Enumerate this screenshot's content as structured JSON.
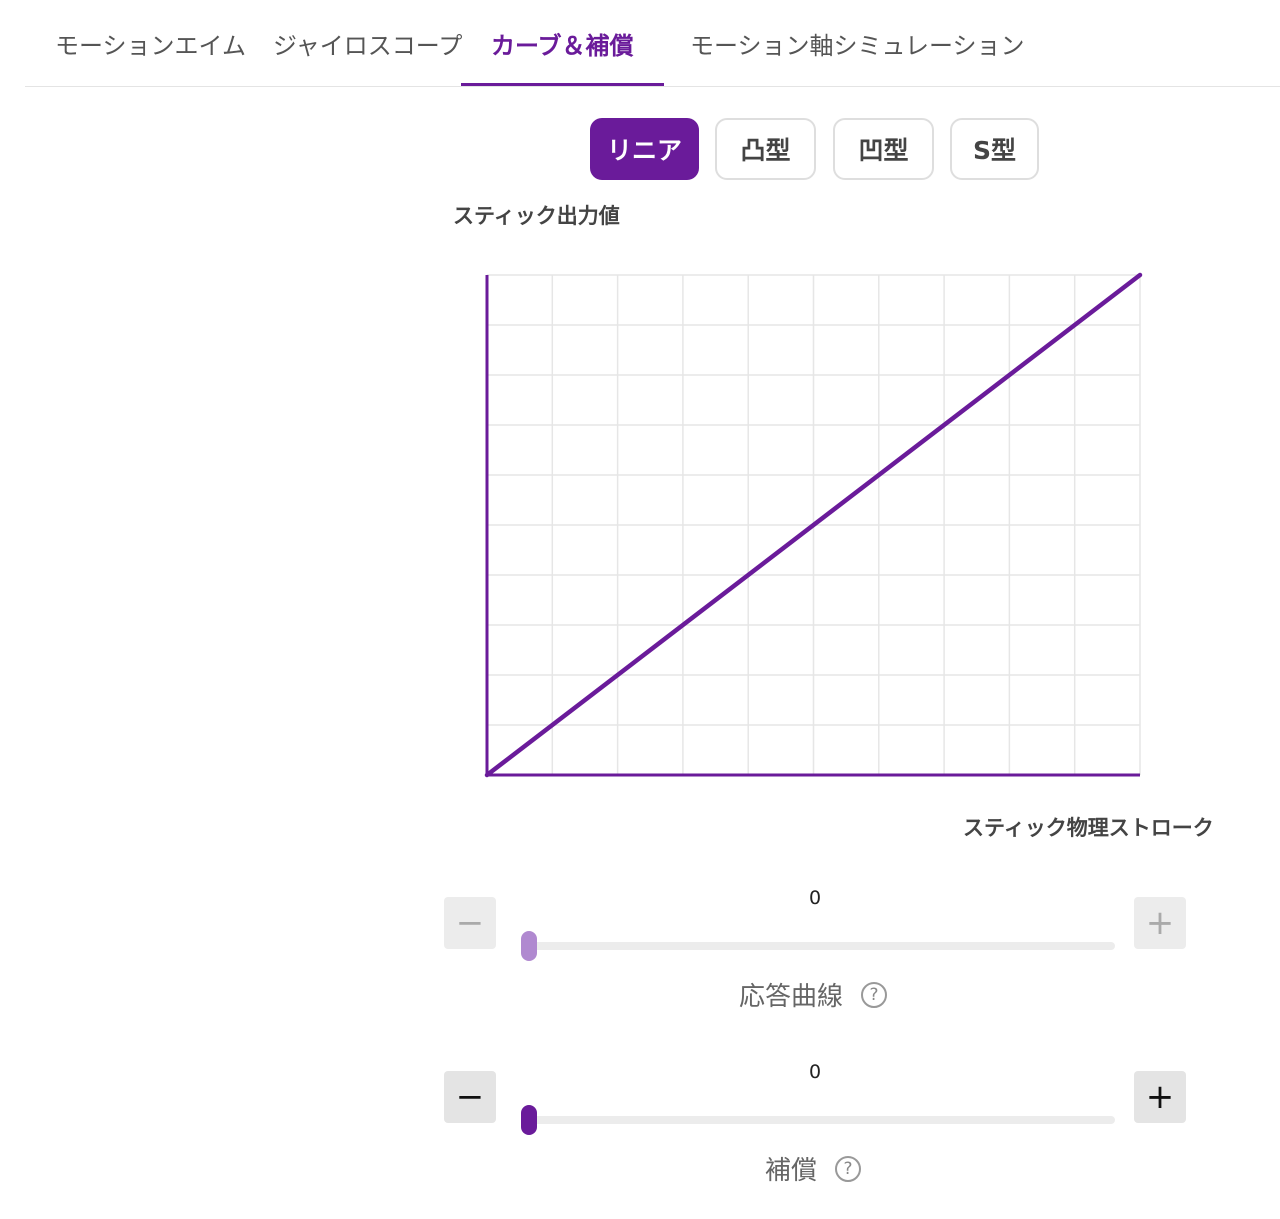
{
  "tabs": [
    {
      "label": "モーションエイム"
    },
    {
      "label": "ジャイロスコープ"
    },
    {
      "label": "カーブ＆補償"
    },
    {
      "label": "モーション軸シミュレーション"
    }
  ],
  "active_tab": "カーブ＆補償",
  "presets": [
    {
      "label": "リニア"
    },
    {
      "label": "凸型"
    },
    {
      "label": "凹型"
    },
    {
      "label": "S型"
    }
  ],
  "active_preset": "リニア",
  "chart": {
    "ylabel": "スティック出力値",
    "xlabel": "スティック物理ストローク"
  },
  "chart_data": {
    "type": "line",
    "xlabel": "スティック物理ストローク",
    "ylabel": "スティック出力値",
    "xlim": [
      0,
      1
    ],
    "ylim": [
      0,
      1
    ],
    "grid": true,
    "grid_divisions": [
      10,
      10
    ],
    "series": [
      {
        "x": [
          0,
          1
        ],
        "y": [
          0,
          1
        ]
      }
    ]
  },
  "sliders": [
    {
      "label": "応答曲線",
      "value": "0",
      "fraction": 0,
      "minus_label": "−",
      "plus_label": "+",
      "help_label": "?"
    },
    {
      "label": "補償",
      "value": "0",
      "fraction": 0,
      "minus_label": "−",
      "plus_label": "+",
      "help_label": "?"
    }
  ],
  "colors": {
    "accent": "#6a1b9a",
    "accent_light": "#b089d0",
    "grid": "#e6e6e6"
  }
}
